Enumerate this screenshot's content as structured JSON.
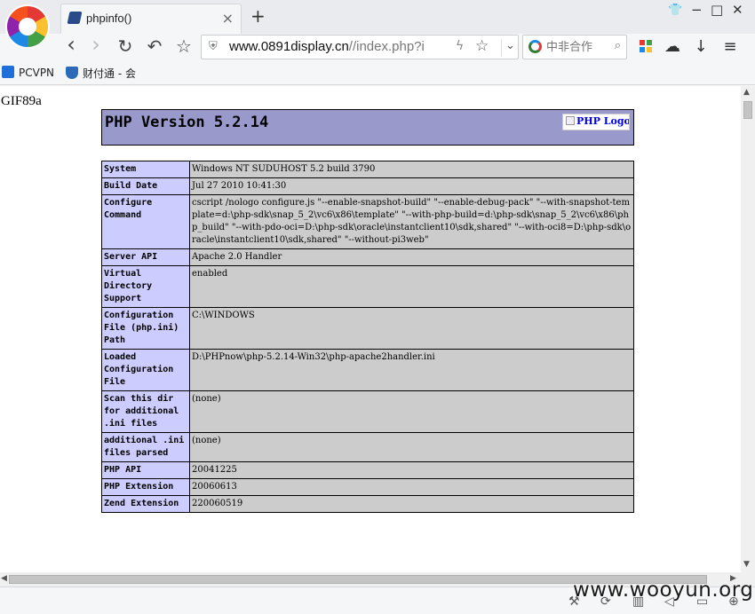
{
  "browser": {
    "tab": {
      "title": "phpinfo()",
      "close": "×"
    },
    "new_tab": "+",
    "window_controls": {
      "skin": "👕",
      "minimize": "−",
      "maximize": "□",
      "close": "✕"
    },
    "nav": {
      "back": "‹",
      "forward": "›",
      "reload": "↻",
      "undo": "↶",
      "favorite": "☆"
    },
    "url": {
      "domain": "www.0891display.cn",
      "path": "//index.php?i",
      "bolt": "ϟ",
      "star": "☆",
      "dropdown": "⌄"
    },
    "search": {
      "placeholder": "中非合作",
      "icon": "⌕"
    },
    "tools": {
      "cloud": "☁",
      "download": "↓",
      "menu": "≡"
    },
    "bookmarks": [
      {
        "label": "PCVPN",
        "icon": "pc-icon",
        "color": "#1e6fd9"
      },
      {
        "label": "财付通 - 会",
        "icon": "shield-t-icon",
        "color": "#2a6ab8"
      }
    ]
  },
  "page": {
    "leading_text": "GIF89a",
    "php_version_title": "PHP Version 5.2.14",
    "php_logo_alt": "PHP Logo",
    "info_rows": [
      {
        "key": "System",
        "value": "Windows NT SUDUHOST 5.2 build 3790"
      },
      {
        "key": "Build Date",
        "value": "Jul 27 2010 10:41:30"
      },
      {
        "key": "Configure Command",
        "value": "cscript /nologo configure.js \"--enable-snapshot-build\" \"--enable-debug-pack\" \"--with-snapshot-template=d:\\php-sdk\\snap_5_2\\vc6\\x86\\template\" \"--with-php-build=d:\\php-sdk\\snap_5_2\\vc6\\x86\\php_build\" \"--with-pdo-oci=D:\\php-sdk\\oracle\\instantclient10\\sdk,shared\" \"--with-oci8=D:\\php-sdk\\oracle\\instantclient10\\sdk,shared\" \"--without-pi3web\""
      },
      {
        "key": "Server API",
        "value": "Apache 2.0 Handler"
      },
      {
        "key": "Virtual Directory Support",
        "value": "enabled"
      },
      {
        "key": "Configuration File (php.ini) Path",
        "value": "C:\\WINDOWS"
      },
      {
        "key": "Loaded Configuration File",
        "value": "D:\\PHPnow\\php-5.2.14-Win32\\php-apache2handler.ini"
      },
      {
        "key": "Scan this dir for additional .ini files",
        "value": "(none)"
      },
      {
        "key": "additional .ini files parsed",
        "value": "(none)"
      },
      {
        "key": "PHP API",
        "value": "20041225"
      },
      {
        "key": "PHP Extension",
        "value": "20060613"
      },
      {
        "key": "Zend Extension",
        "value": "220060519"
      }
    ]
  },
  "watermark": "www.wooyun.org",
  "colors": {
    "header_bg": "#9999cc",
    "key_bg": "#ccccff",
    "value_bg": "#cccccc"
  }
}
